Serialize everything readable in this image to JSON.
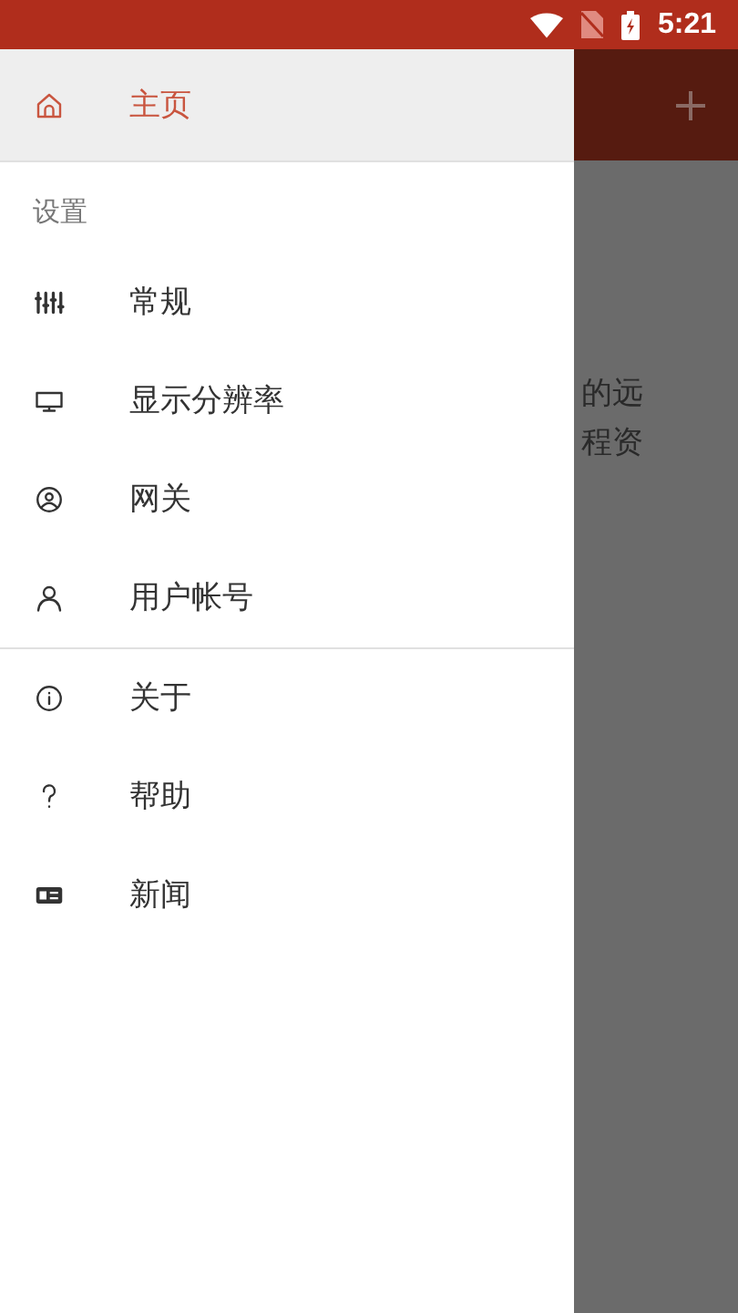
{
  "status_bar": {
    "time": "5:21"
  },
  "drawer": {
    "sections": [
      {
        "items": [
          {
            "label": "主页",
            "selected": true
          }
        ]
      },
      {
        "header": "设置",
        "items": [
          {
            "label": "常规",
            "selected": false
          },
          {
            "label": "显示分辨率",
            "selected": false
          },
          {
            "label": "网关",
            "selected": false
          },
          {
            "label": "用户帐号",
            "selected": false
          }
        ]
      },
      {
        "items": [
          {
            "label": "关于",
            "selected": false
          },
          {
            "label": "帮助",
            "selected": false
          },
          {
            "label": "新闻",
            "selected": false
          }
        ]
      }
    ]
  },
  "background": {
    "lines": [
      "的远",
      "程资"
    ]
  }
}
